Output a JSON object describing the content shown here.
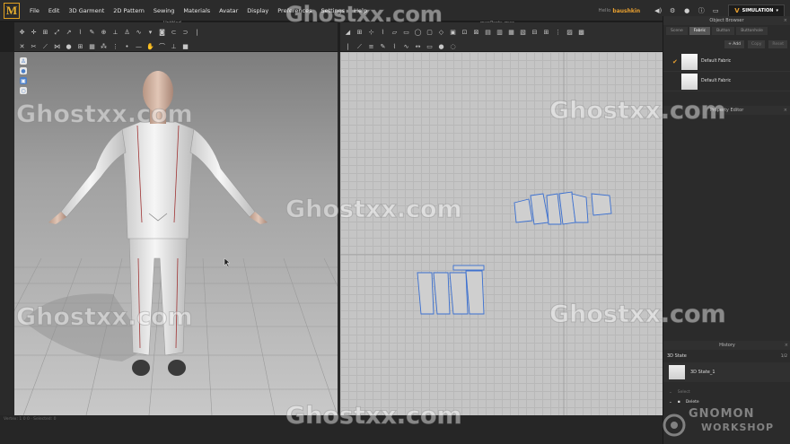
{
  "app": {
    "logo": "M"
  },
  "menu": [
    "File",
    "Edit",
    "3D Garment",
    "2D Pattern",
    "Sewing",
    "Materials",
    "Avatar",
    "Display",
    "Preferences",
    "Settings",
    "Help"
  ],
  "topright": {
    "user_label": "Hello",
    "user_name": "baushkin",
    "simulation_label": "SIMULATION",
    "icons": [
      "speaker-icon",
      "settings-icon",
      "user-icon",
      "info-icon",
      "layout-icon"
    ]
  },
  "view3d": {
    "title": "Untitled"
  },
  "view2d": {
    "title": "manPants.zpac"
  },
  "object_browser": {
    "title": "Object Browser",
    "tabs": [
      "Scene",
      "Fabric",
      "Button",
      "Buttonhole"
    ],
    "active_tab": "Fabric",
    "actions": {
      "add": "+ Add",
      "copy": "Copy",
      "reset": "Reset"
    },
    "fabrics": [
      {
        "name": "Default Fabric",
        "checked": true
      },
      {
        "name": "Default Fabric",
        "checked": false
      }
    ]
  },
  "property_editor": {
    "title": "Property Editor"
  },
  "history": {
    "title": "History",
    "state_label": "3D State",
    "state_count": "1/2",
    "item": "3D State_1",
    "select_label": "Select",
    "delete_label": "Delete"
  },
  "status": {
    "text": "Vertex: 1 0 0 · Selected: 0"
  },
  "watermarks": [
    "Ghostxx.com",
    "Ghostxx.com",
    "Ghostxx.com",
    "Ghostxx.com",
    "Ghostxx.com",
    "Ghostxx.com",
    "Ghostxx.com",
    "Ghostxx.com",
    "Ghostxx.com"
  ],
  "brand": {
    "line1": "GNOMON",
    "line2": "WORKSHOP"
  },
  "colors": {
    "accent": "#e8a030",
    "pattern_line": "#3a6fd0",
    "bg": "#1f1f1f"
  }
}
